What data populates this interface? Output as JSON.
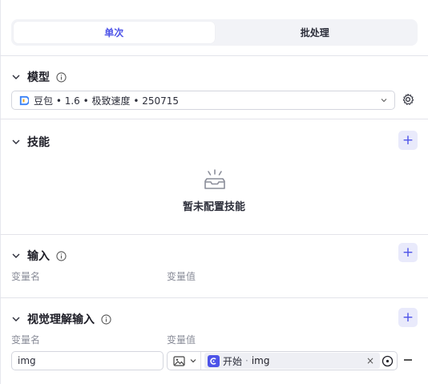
{
  "mode_tabs": {
    "single": "单次",
    "batch": "批处理"
  },
  "model_section": {
    "title": "模型",
    "selected_model": "豆包 • 1.6 • 极致速度 • 250715"
  },
  "skills_section": {
    "title": "技能",
    "empty_text": "暂未配置技能"
  },
  "input_section": {
    "title": "输入",
    "col_name": "变量名",
    "col_value": "变量值"
  },
  "visual_section": {
    "title": "视觉理解输入",
    "col_name": "变量名",
    "col_value": "变量值",
    "rows": [
      {
        "name": "img",
        "ref_node": "开始",
        "ref_sep": "·",
        "ref_var": "img",
        "clear": "×"
      }
    ]
  },
  "colors": {
    "accent": "#4d53e8",
    "accent_bg": "#e9eafb"
  },
  "icons": [
    "chevron-down-icon",
    "info-icon",
    "gear-icon",
    "plus-icon",
    "empty-tray-icon",
    "image-icon",
    "start-node-icon",
    "target-icon",
    "minus-icon",
    "close-icon"
  ]
}
